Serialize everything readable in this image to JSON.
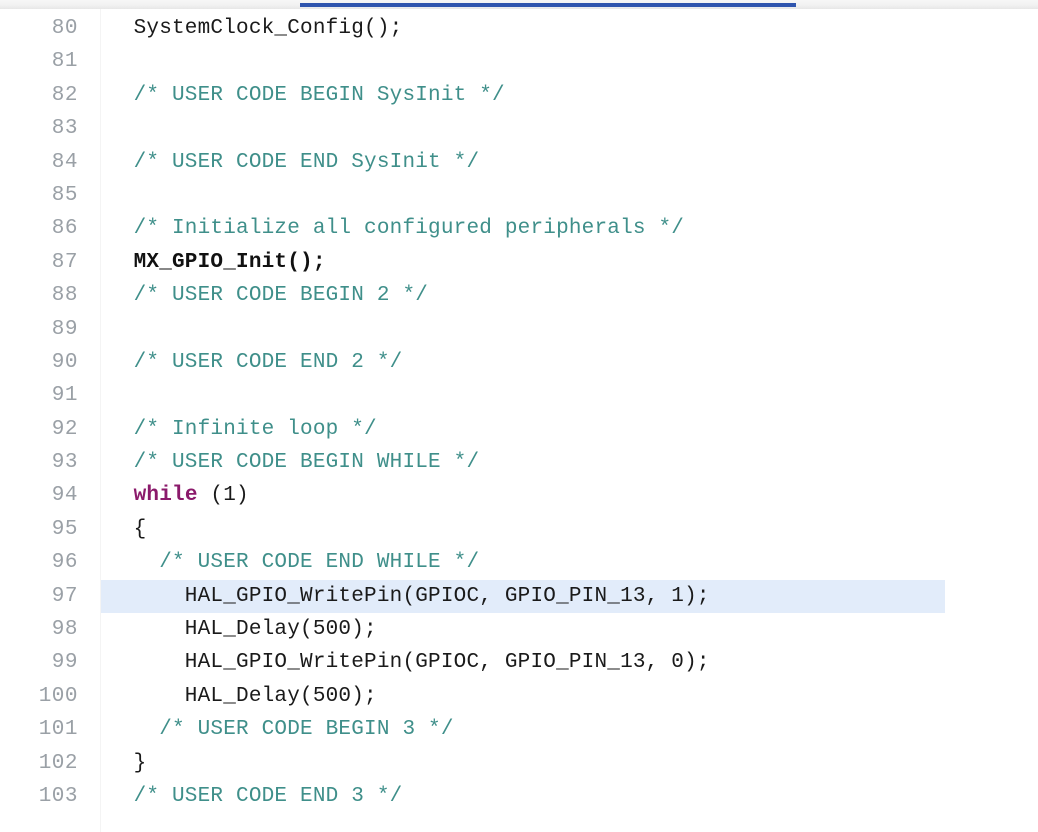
{
  "editor": {
    "first_line_number": 80,
    "current_line_number": 97,
    "colors": {
      "comment": "#3f8f8a",
      "keyword": "#8b1a6b",
      "plain": "#1a1a1a",
      "line_number": "#9aa0a6",
      "current_line_highlight": "#e2ecfa",
      "tab_underline": "#2f55ae",
      "background": "#ffffff"
    },
    "tab_underline_label": "active-tab-underline",
    "lines": [
      {
        "number": "80",
        "tokens": [
          {
            "text": "  SystemClock_Config();",
            "type": "plain"
          }
        ]
      },
      {
        "number": "81",
        "tokens": [
          {
            "text": "",
            "type": "plain"
          }
        ]
      },
      {
        "number": "82",
        "tokens": [
          {
            "text": "  /* USER CODE BEGIN SysInit */",
            "type": "comment"
          }
        ]
      },
      {
        "number": "83",
        "tokens": [
          {
            "text": "",
            "type": "plain"
          }
        ]
      },
      {
        "number": "84",
        "tokens": [
          {
            "text": "  /* USER CODE END SysInit */",
            "type": "comment"
          }
        ]
      },
      {
        "number": "85",
        "tokens": [
          {
            "text": "",
            "type": "plain"
          }
        ]
      },
      {
        "number": "86",
        "tokens": [
          {
            "text": "  /* Initialize all configured peripherals */",
            "type": "comment"
          }
        ]
      },
      {
        "number": "87",
        "tokens": [
          {
            "text": "  MX_GPIO_Init();",
            "type": "bold"
          }
        ]
      },
      {
        "number": "88",
        "tokens": [
          {
            "text": "  /* USER CODE BEGIN 2 */",
            "type": "comment"
          }
        ]
      },
      {
        "number": "89",
        "tokens": [
          {
            "text": "",
            "type": "plain"
          }
        ]
      },
      {
        "number": "90",
        "tokens": [
          {
            "text": "  /* USER CODE END 2 */",
            "type": "comment"
          }
        ]
      },
      {
        "number": "91",
        "tokens": [
          {
            "text": "",
            "type": "plain"
          }
        ]
      },
      {
        "number": "92",
        "tokens": [
          {
            "text": "  /* Infinite loop */",
            "type": "comment"
          }
        ]
      },
      {
        "number": "93",
        "tokens": [
          {
            "text": "  /* USER CODE BEGIN WHILE */",
            "type": "comment"
          }
        ]
      },
      {
        "number": "94",
        "tokens": [
          {
            "text": "  ",
            "type": "plain"
          },
          {
            "text": "while",
            "type": "keyword"
          },
          {
            "text": " (1)",
            "type": "plain"
          }
        ]
      },
      {
        "number": "95",
        "tokens": [
          {
            "text": "  {",
            "type": "plain"
          }
        ]
      },
      {
        "number": "96",
        "tokens": [
          {
            "text": "    /* USER CODE END WHILE */",
            "type": "comment"
          }
        ]
      },
      {
        "number": "97",
        "current": true,
        "tokens": [
          {
            "text": "      HAL_GPIO_WritePin(GPIOC, GPIO_PIN_13, 1);",
            "type": "plain"
          }
        ]
      },
      {
        "number": "98",
        "tokens": [
          {
            "text": "      HAL_Delay(500);",
            "type": "plain"
          }
        ]
      },
      {
        "number": "99",
        "tokens": [
          {
            "text": "      HAL_GPIO_WritePin(GPIOC, GPIO_PIN_13, 0);",
            "type": "plain"
          }
        ]
      },
      {
        "number": "100",
        "tokens": [
          {
            "text": "      HAL_Delay(500);",
            "type": "plain"
          }
        ]
      },
      {
        "number": "101",
        "tokens": [
          {
            "text": "    /* USER CODE BEGIN 3 */",
            "type": "comment"
          }
        ]
      },
      {
        "number": "102",
        "tokens": [
          {
            "text": "  }",
            "type": "plain"
          }
        ]
      },
      {
        "number": "103",
        "tokens": [
          {
            "text": "  /* USER CODE END 3 */",
            "type": "comment"
          }
        ]
      }
    ]
  }
}
